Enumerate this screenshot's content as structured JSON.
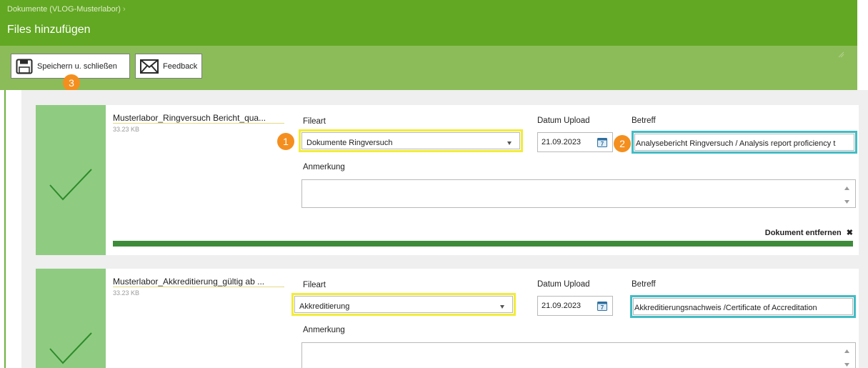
{
  "header": {
    "breadcrumb": "Dokumente (VLOG-Musterlabor)",
    "breadcrumb_separator": "›",
    "title": "Files hinzufügen"
  },
  "toolbar": {
    "save_label": "Speichern u. schließen",
    "feedback_label": "Feedback"
  },
  "badges": [
    "1",
    "2",
    "3"
  ],
  "labels": {
    "fileart": "Fileart",
    "datum_upload": "Datum Upload",
    "betreff": "Betreff",
    "anmerkung": "Anmerkung"
  },
  "files": [
    {
      "name": "Musterlabor_Ringversuch Bericht_qua...",
      "size": "33.23 KB",
      "fileart": "Dokumente Ringversuch",
      "datum": "21.09.2023",
      "betreff": "Analysebericht Ringversuch / Analysis report proficiency t",
      "anmerkung": "",
      "remove_label": "Dokument entfernen",
      "remove_icon": "✖",
      "upload_progress": 1.0
    },
    {
      "name": "Musterlabor_Akkreditierung_gültig ab ...",
      "size": "33.23 KB",
      "fileart": "Akkreditierung",
      "datum": "21.09.2023",
      "betreff": "Akkreditierungsnachweis /Certificate of Accreditation",
      "anmerkung": ""
    }
  ],
  "icons": {
    "save": "save-icon",
    "feedback": "envelope-icon",
    "status": "check-icon",
    "calendar": "calendar-icon",
    "dropdown": "chevron-down-icon"
  },
  "colors": {
    "header": "#62a822",
    "toolbar": "#8cbc5a",
    "success": "#8fcc82",
    "progress": "#3e8c3a",
    "highlight_yellow": "#f2ec3b",
    "highlight_cyan": "#42bcc4",
    "badge": "#f48f1f"
  }
}
